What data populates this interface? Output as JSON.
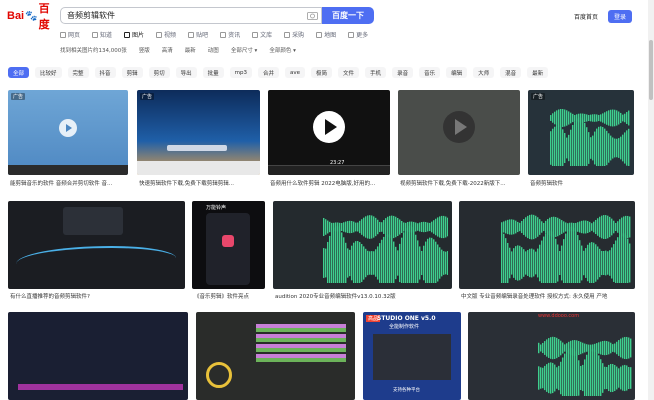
{
  "logo": {
    "part1": "Bai",
    "paw": "🐾",
    "part2": "百度"
  },
  "search": {
    "query": "音频剪辑软件",
    "button": "百度一下"
  },
  "top_links": {
    "home": "百度首页",
    "login": "登录"
  },
  "tabs": [
    {
      "label": "网页"
    },
    {
      "label": "知道"
    },
    {
      "label": "图片"
    },
    {
      "label": "视频"
    },
    {
      "label": "贴吧"
    },
    {
      "label": "资讯"
    },
    {
      "label": "文库"
    },
    {
      "label": "采购"
    },
    {
      "label": "地图"
    },
    {
      "label": "更多"
    }
  ],
  "filters": {
    "result_count": "找到相关图片约134,000张",
    "items": [
      "竖版",
      "高清",
      "最新",
      "动图",
      "全部尺寸 ▾",
      "全部颜色 ▾"
    ]
  },
  "chips": [
    "全部",
    "比较好",
    "完整",
    "抖音",
    "剪辑",
    "剪切",
    "导出",
    "批量",
    "mp3",
    "合并",
    "ave",
    "极简",
    "文件",
    "手机",
    "录音",
    "音乐",
    "编辑",
    "大师",
    "混音",
    "最新"
  ],
  "row1": [
    {
      "badge": "广告",
      "caption": "能剪辑音乐的软件 音频合并剪切软件 音..."
    },
    {
      "badge": "广告",
      "caption": "快速剪辑软件下载,免费下载剪辑剪辑..."
    },
    {
      "badge": "",
      "caption": "音频用什么软件剪辑 2022电脑版,好用的..."
    },
    {
      "badge": "",
      "caption": "视频剪辑软件下载,免费下载-2022新版下..."
    },
    {
      "badge": "广告",
      "caption": "音频剪辑软件"
    }
  ],
  "row1_player": {
    "time": "23:27"
  },
  "row2": [
    {
      "caption": "有什么直播推荐的音频剪辑软件?"
    },
    {
      "caption": "《音乐剪辑》软件亮点",
      "title": "万能铃声"
    },
    {
      "caption": "audition 2020专业音频编辑软件v13.0.10.32版"
    },
    {
      "caption": "中文版 专业音频编辑录音处理软件 授权方式: 永久使用 产地"
    }
  ],
  "row3": [
    {
      "caption": ""
    },
    {
      "caption": ""
    },
    {
      "caption": "",
      "title": "STUDIO ONE v5.0",
      "subtitle": "全能制作软件",
      "badge": "高品",
      "footer": "支持各种平台"
    },
    {
      "caption": "",
      "watermark": "www.ddooo.com"
    }
  ],
  "colors": {
    "accent": "#4e6ef2",
    "wave": "#3ecf8e",
    "brand_red": "#e10601",
    "brand_blue": "#2932e1"
  }
}
